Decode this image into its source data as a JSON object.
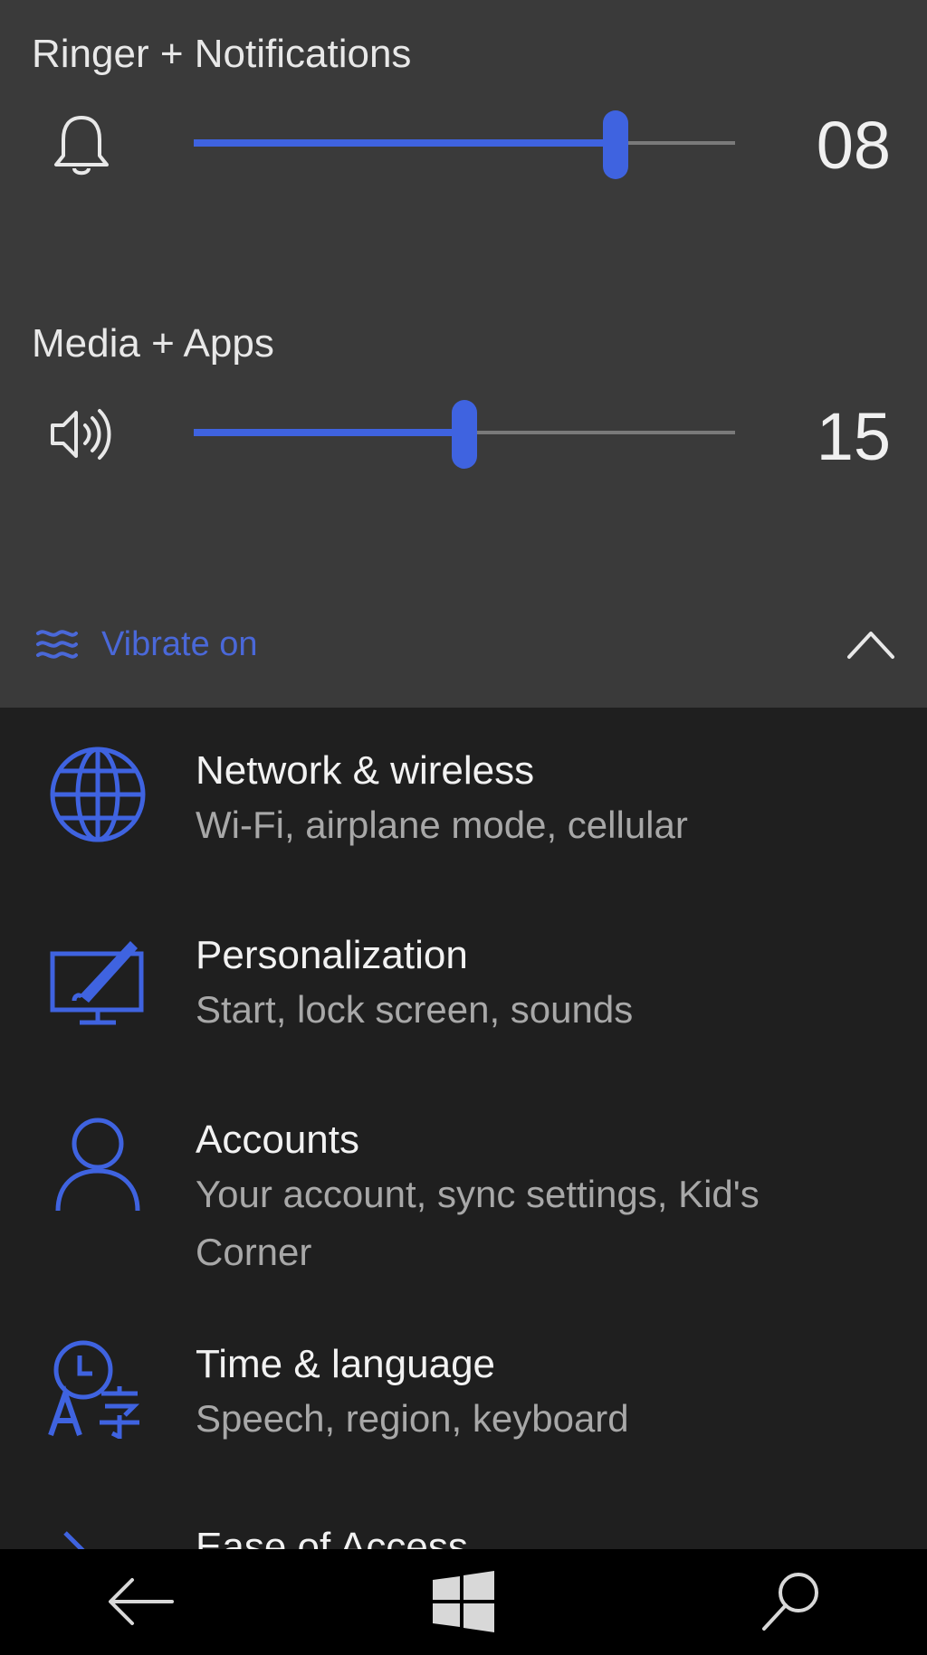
{
  "volume": {
    "ringer": {
      "label": "Ringer + Notifications",
      "icon": "bell-icon",
      "value_text": "08",
      "level_fraction": 0.78
    },
    "media": {
      "label": "Media + Apps",
      "icon": "speaker-icon",
      "value_text": "15",
      "level_fraction": 0.5
    },
    "vibrate": {
      "label": "Vibrate on",
      "icon": "vibrate-icon"
    },
    "collapse_icon": "chevron-up-icon"
  },
  "settings": {
    "items": [
      {
        "title": "Network & wireless",
        "description": "Wi-Fi, airplane mode, cellular",
        "icon": "globe-icon"
      },
      {
        "title": "Personalization",
        "description": "Start, lock screen, sounds",
        "icon": "personalization-icon"
      },
      {
        "title": "Accounts",
        "description": "Your account, sync settings, Kid's Corner",
        "icon": "person-icon"
      },
      {
        "title": "Time & language",
        "description": "Speech, region, keyboard",
        "icon": "time-language-icon"
      },
      {
        "title": "Ease of Access",
        "description": "",
        "icon": "ease-of-access-icon"
      }
    ]
  },
  "navbar": {
    "back_icon": "back-arrow-icon",
    "start_icon": "windows-logo-icon",
    "search_icon": "search-icon"
  },
  "colors": {
    "accent": "#3f63e0",
    "panel_bg": "#3a3a3a",
    "list_bg": "#1f1f1f",
    "navbar_bg": "#000000"
  }
}
